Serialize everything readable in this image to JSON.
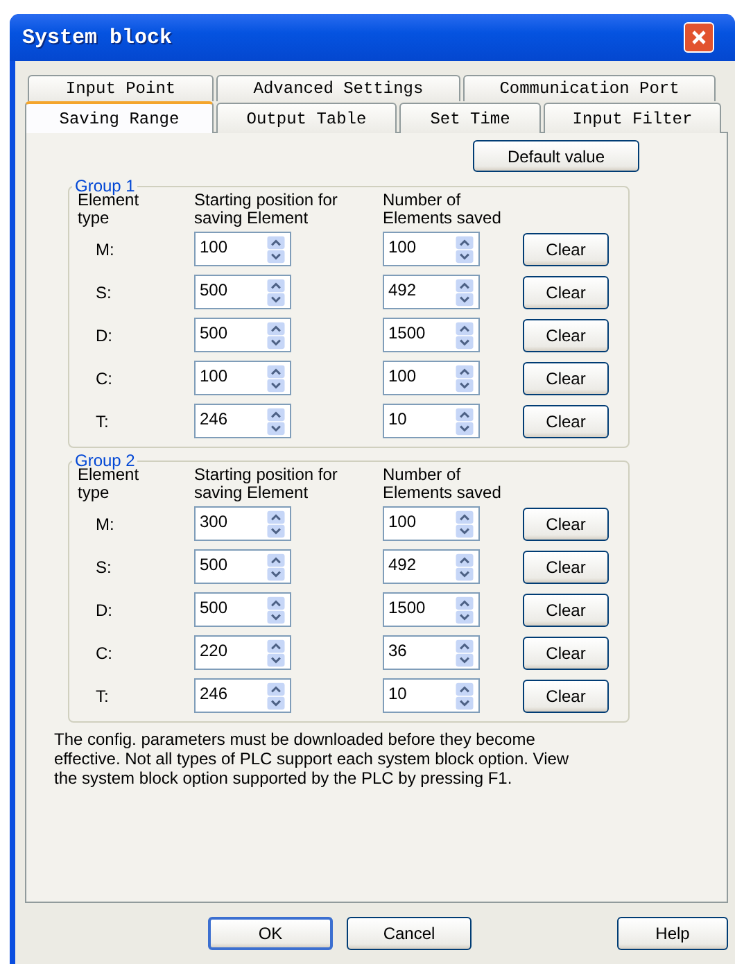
{
  "window": {
    "title": "System block"
  },
  "tab_rows": [
    [
      {
        "label": "Input Point",
        "selected": false
      },
      {
        "label": "Advanced Settings",
        "selected": false
      },
      {
        "label": "Communication Port",
        "selected": false
      }
    ],
    [
      {
        "label": "Saving Range",
        "selected": true
      },
      {
        "label": "Output Table",
        "selected": false
      },
      {
        "label": "Set Time",
        "selected": false
      },
      {
        "label": "Input Filter",
        "selected": false
      }
    ]
  ],
  "default_button": "Default value",
  "groups": [
    {
      "title": "Group 1",
      "headers": [
        "Element type",
        "Starting position for saving Element",
        "Number of Elements saved"
      ],
      "rows": [
        {
          "type": "M:",
          "start": "100",
          "count": "100",
          "button": "Clear"
        },
        {
          "type": "S:",
          "start": "500",
          "count": "492",
          "button": "Clear"
        },
        {
          "type": "D:",
          "start": "500",
          "count": "1500",
          "button": "Clear"
        },
        {
          "type": "C:",
          "start": "100",
          "count": "100",
          "button": "Clear"
        },
        {
          "type": "T:",
          "start": "246",
          "count": "10",
          "button": "Clear"
        }
      ]
    },
    {
      "title": "Group 2",
      "headers": [
        "Element type",
        "Starting position for saving Element",
        "Number of Elements saved"
      ],
      "rows": [
        {
          "type": "M:",
          "start": "300",
          "count": "100",
          "button": "Clear"
        },
        {
          "type": "S:",
          "start": "500",
          "count": "492",
          "button": "Clear"
        },
        {
          "type": "D:",
          "start": "500",
          "count": "1500",
          "button": "Clear"
        },
        {
          "type": "C:",
          "start": "220",
          "count": "36",
          "button": "Clear"
        },
        {
          "type": "T:",
          "start": "246",
          "count": "10",
          "button": "Clear"
        }
      ]
    }
  ],
  "note": "The config. parameters must be downloaded before they become effective. Not all types of PLC support each system block option. View the system block option supported by the PLC by pressing F1.",
  "buttons": [
    "OK",
    "Cancel",
    "Help"
  ]
}
